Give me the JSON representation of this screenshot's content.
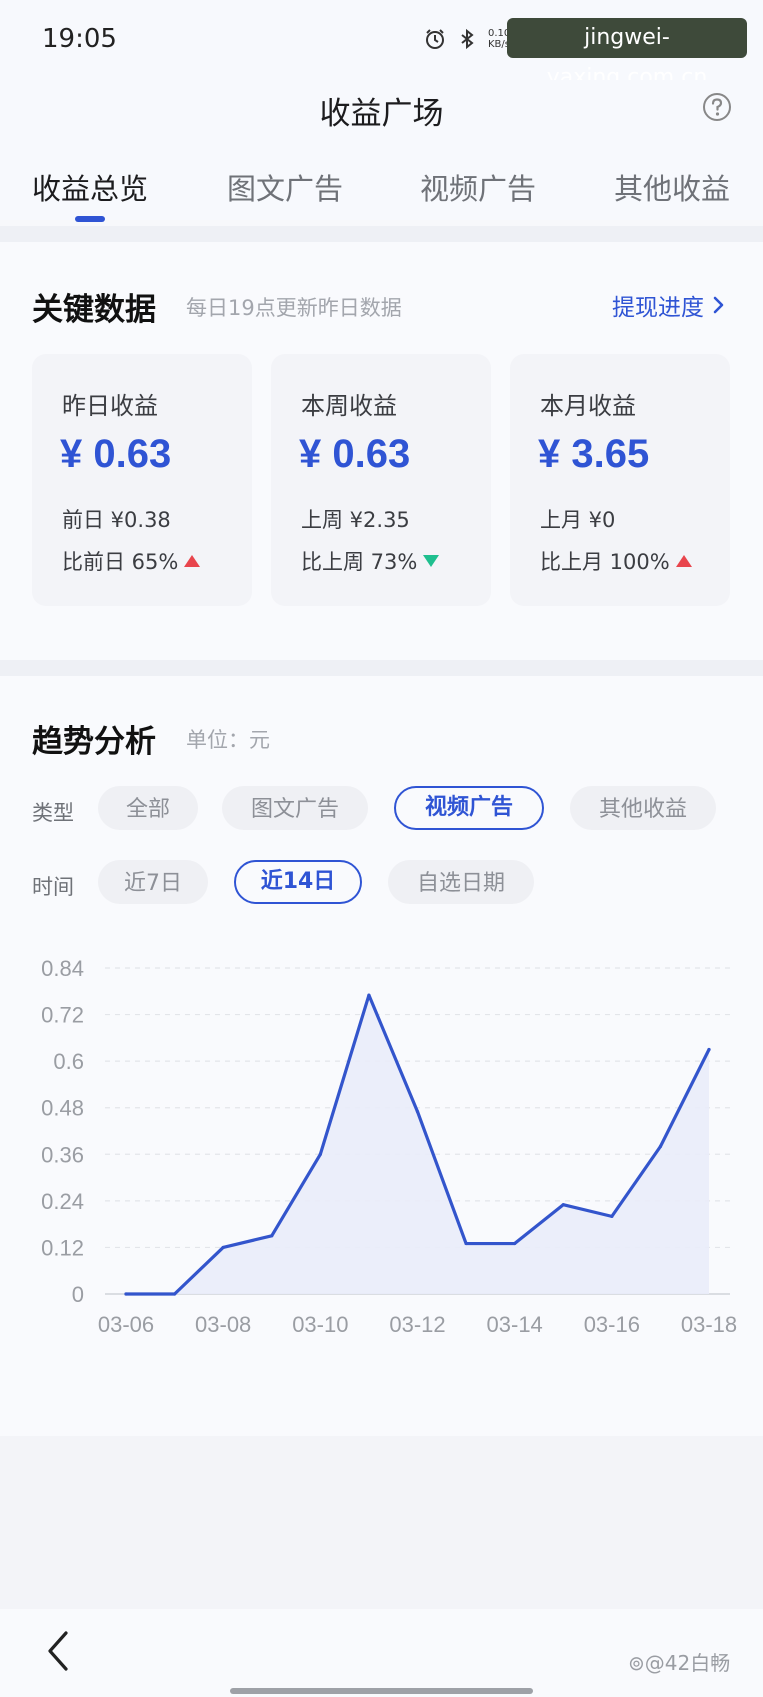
{
  "status_bar": {
    "time": "19:05",
    "net_speed_value": "0.10",
    "net_speed_unit": "KB/s",
    "watermark_url": "jingwei-yaxing.com.cn"
  },
  "header": {
    "title": "收益广场",
    "tabs": [
      {
        "label": "收益总览",
        "active": true
      },
      {
        "label": "图文广告",
        "active": false
      },
      {
        "label": "视频广告",
        "active": false
      },
      {
        "label": "其他收益",
        "active": false
      }
    ]
  },
  "key_data": {
    "title": "关键数据",
    "subtitle": "每日19点更新昨日数据",
    "withdraw_link": "提现进度",
    "cards": [
      {
        "label": "昨日收益",
        "value": "¥ 0.63",
        "prev": "前日 ¥0.38",
        "compare": "比前日 65%",
        "trend": "up"
      },
      {
        "label": "本周收益",
        "value": "¥ 0.63",
        "prev": "上周 ¥2.35",
        "compare": "比上周 73%",
        "trend": "down"
      },
      {
        "label": "本月收益",
        "value": "¥ 3.65",
        "prev": "上月 ¥0",
        "compare": "比上月 100%",
        "trend": "up"
      }
    ]
  },
  "trend": {
    "title": "趋势分析",
    "unit": "单位：元",
    "type_label": "类型",
    "type_options": [
      {
        "label": "全部",
        "selected": false
      },
      {
        "label": "图文广告",
        "selected": false
      },
      {
        "label": "视频广告",
        "selected": true
      },
      {
        "label": "其他收益",
        "selected": false
      }
    ],
    "time_label": "时间",
    "time_options": [
      {
        "label": "近7日",
        "selected": false
      },
      {
        "label": "近14日",
        "selected": true
      },
      {
        "label": "自选日期",
        "selected": false
      }
    ]
  },
  "chart_data": {
    "type": "area",
    "x": [
      "03-06",
      "03-07",
      "03-08",
      "03-09",
      "03-10",
      "03-11",
      "03-12",
      "03-13",
      "03-14",
      "03-15",
      "03-16",
      "03-17",
      "03-18"
    ],
    "series": [
      {
        "values": [
          0,
          0,
          0.12,
          0.15,
          0.36,
          0.77,
          0.47,
          0.13,
          0.13,
          0.23,
          0.2,
          0.38,
          0.63
        ]
      }
    ],
    "yticks": [
      0,
      0.12,
      0.24,
      0.36,
      0.48,
      0.6,
      0.72,
      0.84
    ],
    "ytick_labels": [
      "0",
      "0.12",
      "0.24",
      "0.36",
      "0.48",
      "0.6",
      "0.72",
      "0.84"
    ],
    "xtick_labels": [
      "03-06",
      "03-08",
      "03-10",
      "03-12",
      "03-14",
      "03-16",
      "03-18"
    ],
    "ylim": [
      0,
      0.84
    ],
    "grid": true,
    "colors": {
      "line": "#3355cc",
      "fill": "#e9ecf9"
    }
  },
  "footer": {
    "watermark_user": "⊚@42白畅"
  },
  "colors": {
    "accent": "#2f54d4",
    "up": "#e8454d",
    "down": "#1fbf8f"
  }
}
